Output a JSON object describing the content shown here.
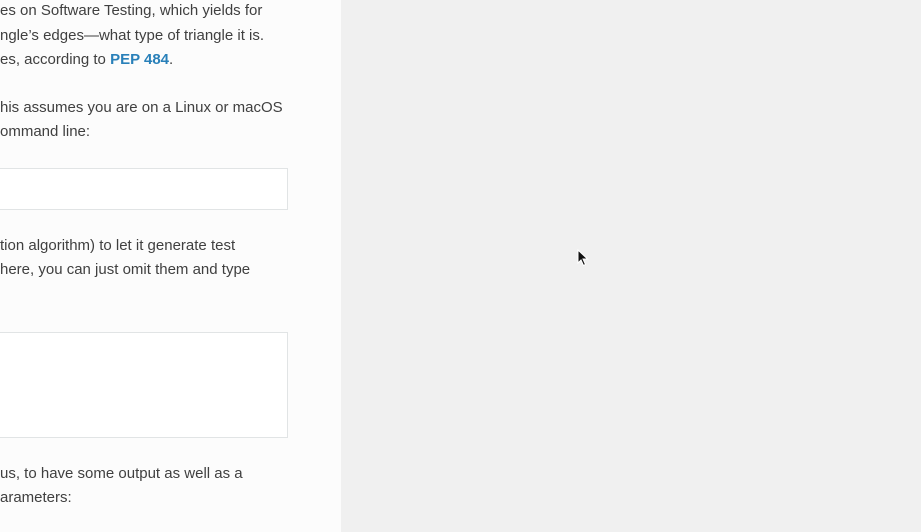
{
  "content": {
    "para1": {
      "line1": "es on Software Testing, which yields for",
      "line2": "ngle’s edges—what type of triangle it is.",
      "line3_prefix": "es, according to ",
      "line3_link": "PEP 484",
      "line3_suffix": "."
    },
    "para2": {
      "line1": "his assumes you are on a Linux or macOS",
      "line2": "ommand line:"
    },
    "para3": {
      "line1": "tion algorithm) to let it generate test",
      "line2": "here, you can just omit them and type"
    },
    "para4": {
      "line1": "us, to have some output as well as a",
      "line2": "arameters:"
    }
  },
  "colors": {
    "link": "#2980b9",
    "text": "#404040",
    "content_bg": "#fcfcfc",
    "pane_bg": "#f0f0f0"
  }
}
